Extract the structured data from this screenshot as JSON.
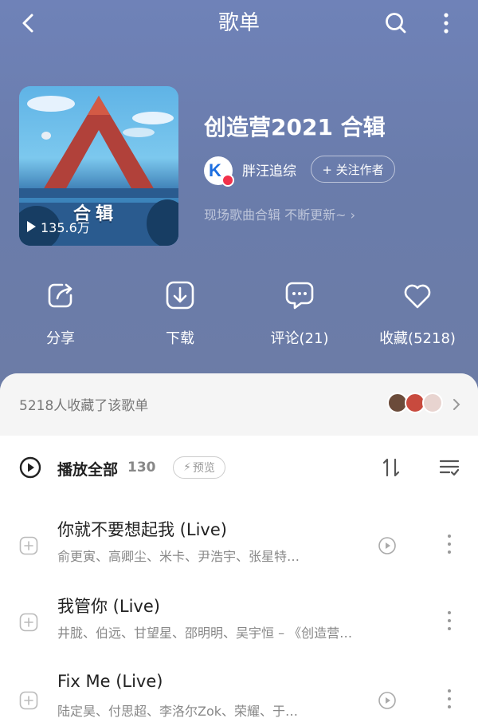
{
  "header": {
    "title": "歌单"
  },
  "playlist": {
    "title": "创造营2021 合辑",
    "cover_text": "合辑",
    "play_count": "135.6万",
    "author": {
      "name": "胖汪追综",
      "avatar_letter": "K"
    },
    "follow_label": "+ 关注作者",
    "description": "现场歌曲合辑 不断更新~ ›"
  },
  "actions": [
    {
      "label": "分享",
      "icon": "share-icon"
    },
    {
      "label": "下载",
      "icon": "download-icon"
    },
    {
      "label": "评论(21)",
      "icon": "comment-icon"
    },
    {
      "label": "收藏(5218)",
      "icon": "heart-icon"
    }
  ],
  "collect_bar": {
    "text": "5218人收藏了该歌单"
  },
  "list_header": {
    "play_all": "播放全部",
    "count": "130",
    "preview": "预览"
  },
  "songs": [
    {
      "title": "你就不要想起我 (Live)",
      "artists": "俞更寅、高卿尘、米卡、尹浩宇、张星特…",
      "has_mv": true
    },
    {
      "title": "我管你 (Live)",
      "artists": "井胧、伯远、甘望星、邵明明、吴宇恒 – 《创造营…",
      "has_mv": false
    },
    {
      "title": "Fix Me (Live)",
      "artists": "陆定昊、付思超、李洛尔Zok、荣耀、于…",
      "has_mv": true
    }
  ],
  "colors": {
    "hero_bg": "#6f82b8",
    "accent_red": "#f2314b",
    "brand_blue": "#1e6fe0"
  }
}
